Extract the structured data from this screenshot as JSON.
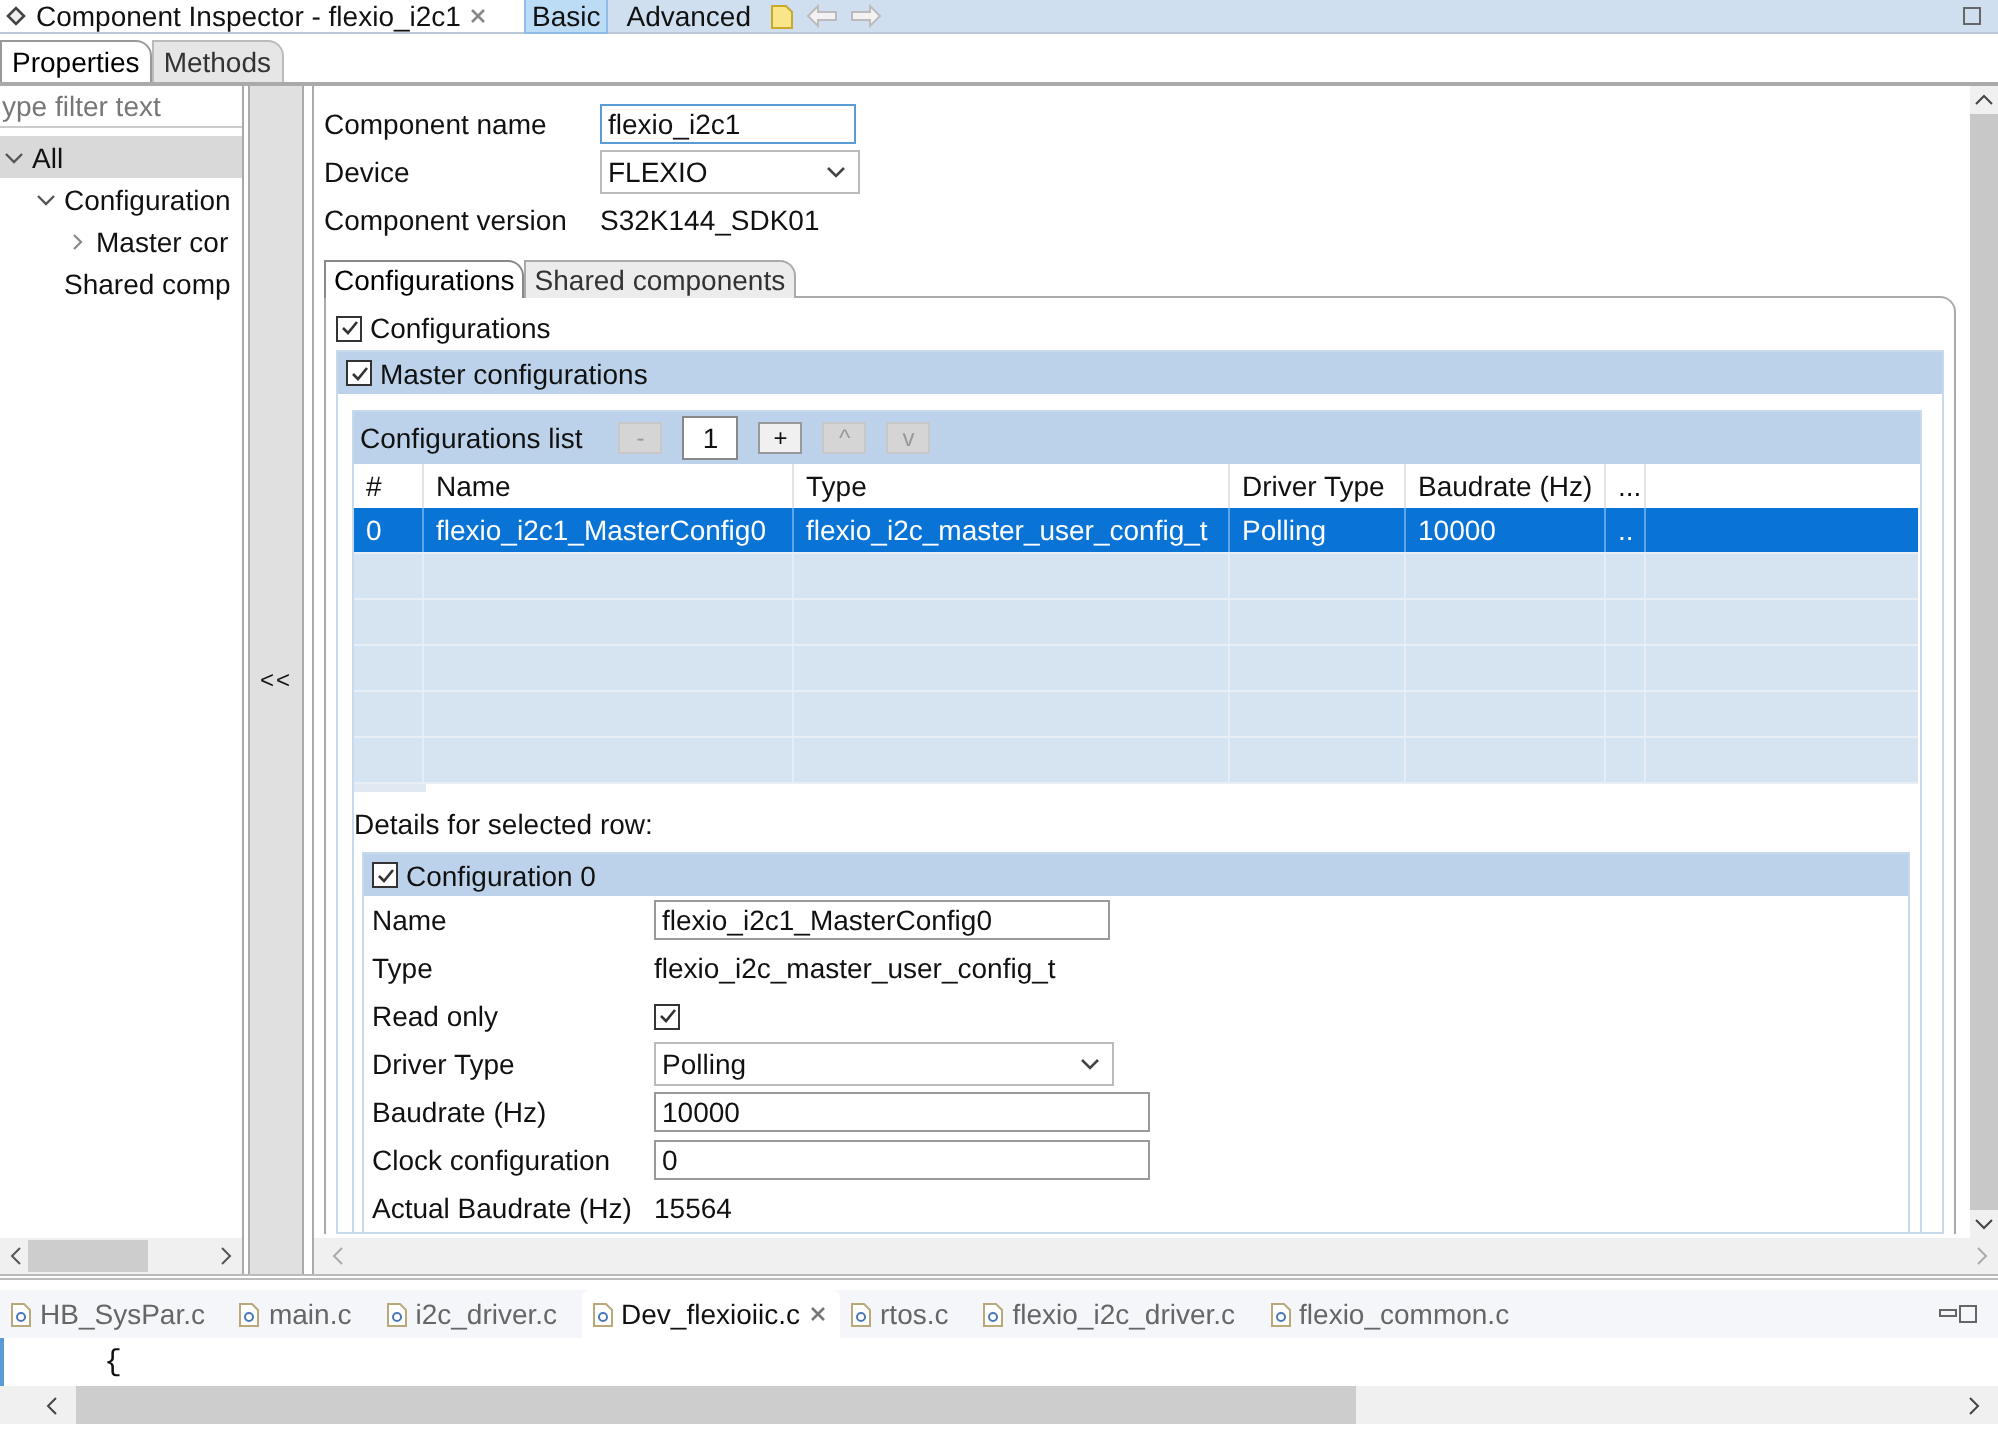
{
  "editor_tab": {
    "title": "Component Inspector - flexio_i2c1"
  },
  "mode_buttons": [
    {
      "label": "Basic",
      "selected": true
    },
    {
      "label": "Advanced",
      "selected": false
    }
  ],
  "view_tabs": [
    {
      "label": "Properties",
      "selected": true
    },
    {
      "label": "Methods",
      "selected": false
    }
  ],
  "sidebar": {
    "filter": {
      "placeholder": "ype filter text"
    },
    "tree": [
      {
        "label": "All",
        "selected": true,
        "expanded": true,
        "children": [
          {
            "label": "Configuration",
            "selected": false,
            "expanded": true,
            "children": [
              {
                "label": "Master cor",
                "selected": false,
                "expanded": false
              }
            ]
          },
          {
            "label": "Shared comp",
            "selected": false
          }
        ]
      }
    ]
  },
  "collapse_button": "<<",
  "component": {
    "fields": [
      {
        "kind": "input",
        "label": "Component name",
        "value": "flexio_i2c1"
      },
      {
        "kind": "dropdown",
        "label": "Device",
        "value": "FLEXIO"
      },
      {
        "kind": "text",
        "label": "Component version",
        "value": "S32K144_SDK01"
      }
    ]
  },
  "config_tabs": [
    {
      "label": "Configurations",
      "selected": true
    },
    {
      "label": "Shared components",
      "selected": false
    }
  ],
  "configurations": {
    "label": "Configurations",
    "checked": true
  },
  "master": {
    "label": "Master configurations",
    "checked": true
  },
  "configurations_list": {
    "title": "Configurations list",
    "count": "1",
    "buttons": [
      {
        "label": "-",
        "disabled": true
      },
      {
        "label": "+",
        "disabled": false
      },
      {
        "label": "^",
        "disabled": true
      },
      {
        "label": "v",
        "disabled": true
      }
    ],
    "columns": [
      "#",
      "Name",
      "Type",
      "Driver Type",
      "Baudrate (Hz)",
      "..."
    ],
    "rows": [
      {
        "cells": [
          "0",
          "flexio_i2c1_MasterConfig0",
          "flexio_i2c_master_user_config_t",
          "Polling",
          "10000",
          ".."
        ],
        "selected": true
      }
    ]
  },
  "details_caption": "Details for selected row:",
  "detail": {
    "title": "Configuration 0",
    "checked": true,
    "fields": [
      {
        "kind": "input",
        "label": "Name",
        "value": "flexio_i2c1_MasterConfig0"
      },
      {
        "kind": "text",
        "label": "Type",
        "value": "flexio_i2c_master_user_config_t"
      },
      {
        "kind": "checkbox",
        "label": "Read only",
        "checked": true
      },
      {
        "kind": "dropdown",
        "label": "Driver Type",
        "value": "Polling"
      },
      {
        "kind": "input",
        "label": "Baudrate (Hz)",
        "value": "10000"
      },
      {
        "kind": "input",
        "label": "Clock configuration",
        "value": "0"
      },
      {
        "kind": "text",
        "label": "Actual Baudrate (Hz)",
        "value": "15564"
      }
    ]
  },
  "file_tabs": [
    {
      "label": "HB_SysPar.c",
      "selected": false
    },
    {
      "label": "main.c",
      "selected": false
    },
    {
      "label": "i2c_driver.c",
      "selected": false
    },
    {
      "label": "Dev_flexioiic.c",
      "selected": true
    },
    {
      "label": "rtos.c",
      "selected": false
    },
    {
      "label": "flexio_i2c_driver.c",
      "selected": false
    },
    {
      "label": "flexio_common.c",
      "selected": false
    }
  ],
  "code_lines": [
    "{"
  ]
}
